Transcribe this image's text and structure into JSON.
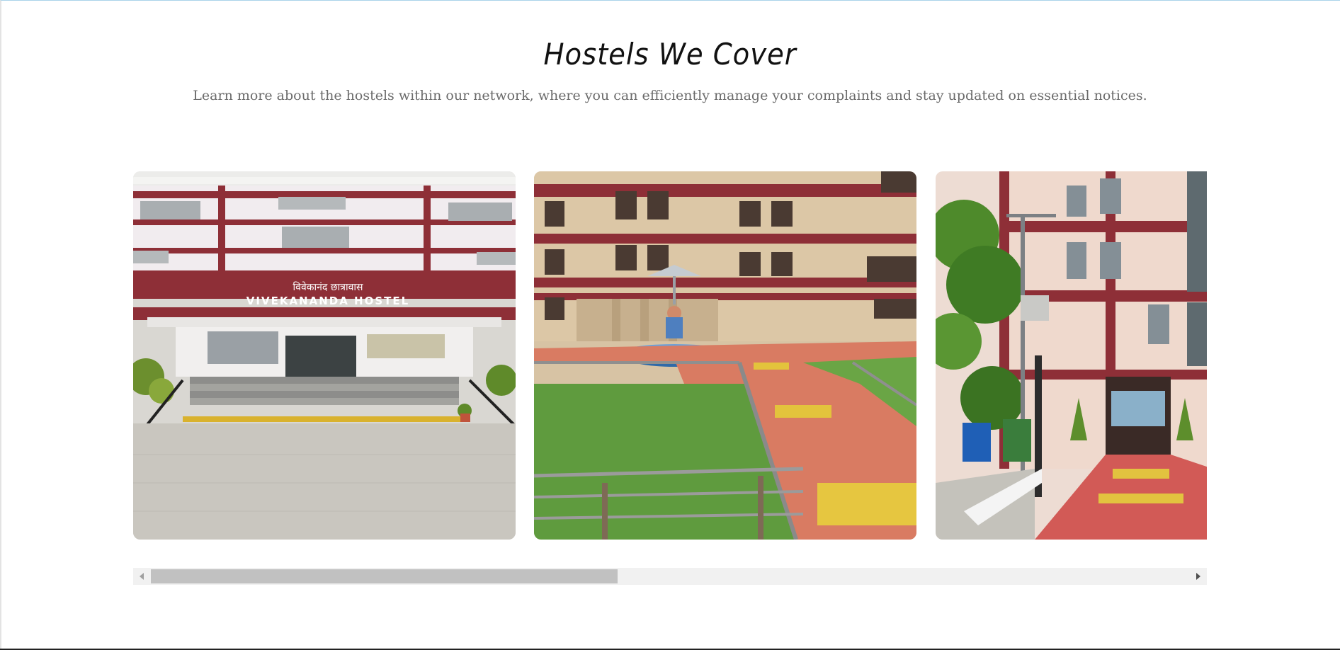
{
  "section": {
    "title": "Hostels We Cover",
    "subtitle": "Learn more about the hostels within our network, where you can efficiently manage your complaints and stay updated on essential notices."
  },
  "hostels": [
    {
      "image": "hostel-photo-1",
      "sign_hindi": "विवेकानंद छात्रावास",
      "sign_english": "VIVEKANANDA HOSTEL"
    },
    {
      "image": "hostel-photo-2"
    },
    {
      "image": "hostel-photo-3"
    }
  ],
  "scrollbar": {
    "position_fraction": 0.0
  },
  "colors": {
    "heading": "#111111",
    "subtitle": "#6b6b6b",
    "maroon": "#8e2f37",
    "track": "#f1f1f1",
    "thumb": "#c1c1c1"
  },
  "icons": {
    "scroll_left": "triangle-left-icon",
    "scroll_right": "triangle-right-icon"
  }
}
